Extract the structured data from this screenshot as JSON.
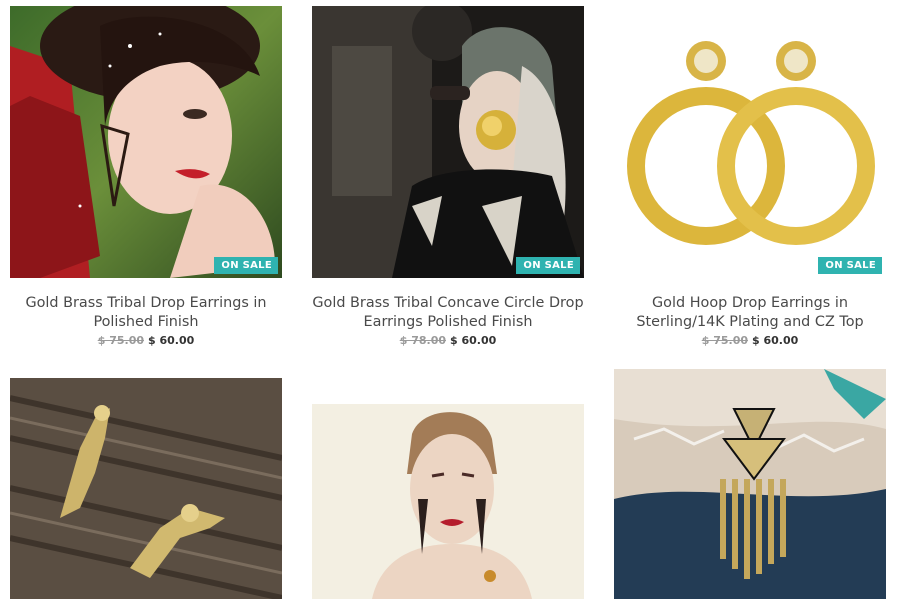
{
  "products": [
    {
      "title_line1": "Gold Brass Tribal Drop Earrings in",
      "title_line2": "Polished Finish",
      "old_price": "$ 75.00",
      "new_price": "$ 60.00",
      "badge": "ON SALE",
      "image": "woman-red-jacket-triangle-earrings"
    },
    {
      "title_line1": "Gold Brass Tribal Concave Circle Drop",
      "title_line2": "Earrings Polished Finish",
      "old_price": "$ 78.00",
      "new_price": "$ 60.00",
      "badge": "ON SALE",
      "image": "woman-knit-cap-gold-disc-earring"
    },
    {
      "title_line1": "Gold Hoop Drop Earrings in",
      "title_line2": "Sterling/14K Plating and CZ Top",
      "old_price": "$ 75.00",
      "new_price": "$ 60.00",
      "badge": "ON SALE",
      "image": "gold-hoop-earrings"
    },
    {
      "image": "gold-figure-earrings-on-wood"
    },
    {
      "image": "woman-portrait-spike-earrings"
    },
    {
      "image": "tribal-fringe-pendant"
    }
  ],
  "colors": {
    "badge": "#2fb3b0",
    "title": "#4a4a4a",
    "old_price": "#9a9a9a",
    "new_price": "#333333"
  }
}
